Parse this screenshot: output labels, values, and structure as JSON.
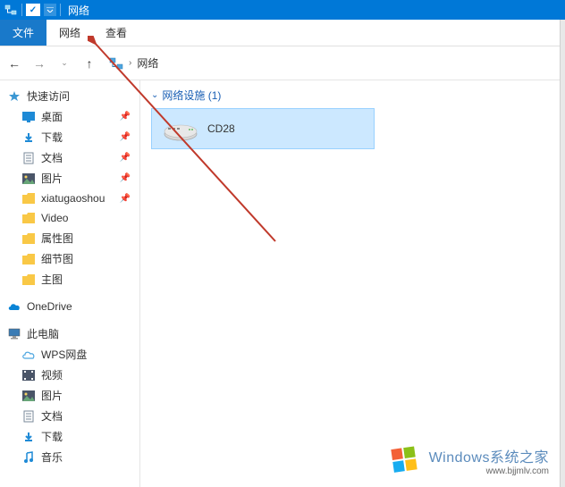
{
  "titlebar": {
    "title": "网络"
  },
  "ribbon": {
    "file": "文件",
    "network": "网络",
    "view": "查看"
  },
  "nav": {
    "location": "网络"
  },
  "sidebar": {
    "quick_access": "快速访问",
    "quick_items": [
      {
        "label": "桌面",
        "pinned": true
      },
      {
        "label": "下载",
        "pinned": true
      },
      {
        "label": "文档",
        "pinned": true
      },
      {
        "label": "图片",
        "pinned": true
      },
      {
        "label": "xiatugaoshou",
        "pinned": true
      },
      {
        "label": "Video",
        "pinned": false
      },
      {
        "label": "属性图",
        "pinned": false
      },
      {
        "label": "细节图",
        "pinned": false
      },
      {
        "label": "主图",
        "pinned": false
      }
    ],
    "onedrive": "OneDrive",
    "this_pc": "此电脑",
    "pc_items": [
      {
        "label": "WPS网盘"
      },
      {
        "label": "视频"
      },
      {
        "label": "图片"
      },
      {
        "label": "文档"
      },
      {
        "label": "下载"
      },
      {
        "label": "音乐"
      }
    ]
  },
  "main": {
    "group_label": "网络设施 (1)",
    "device_label": "CD28"
  },
  "watermark": {
    "title": "Windows系统之家",
    "url": "www.bjjmlv.com"
  }
}
